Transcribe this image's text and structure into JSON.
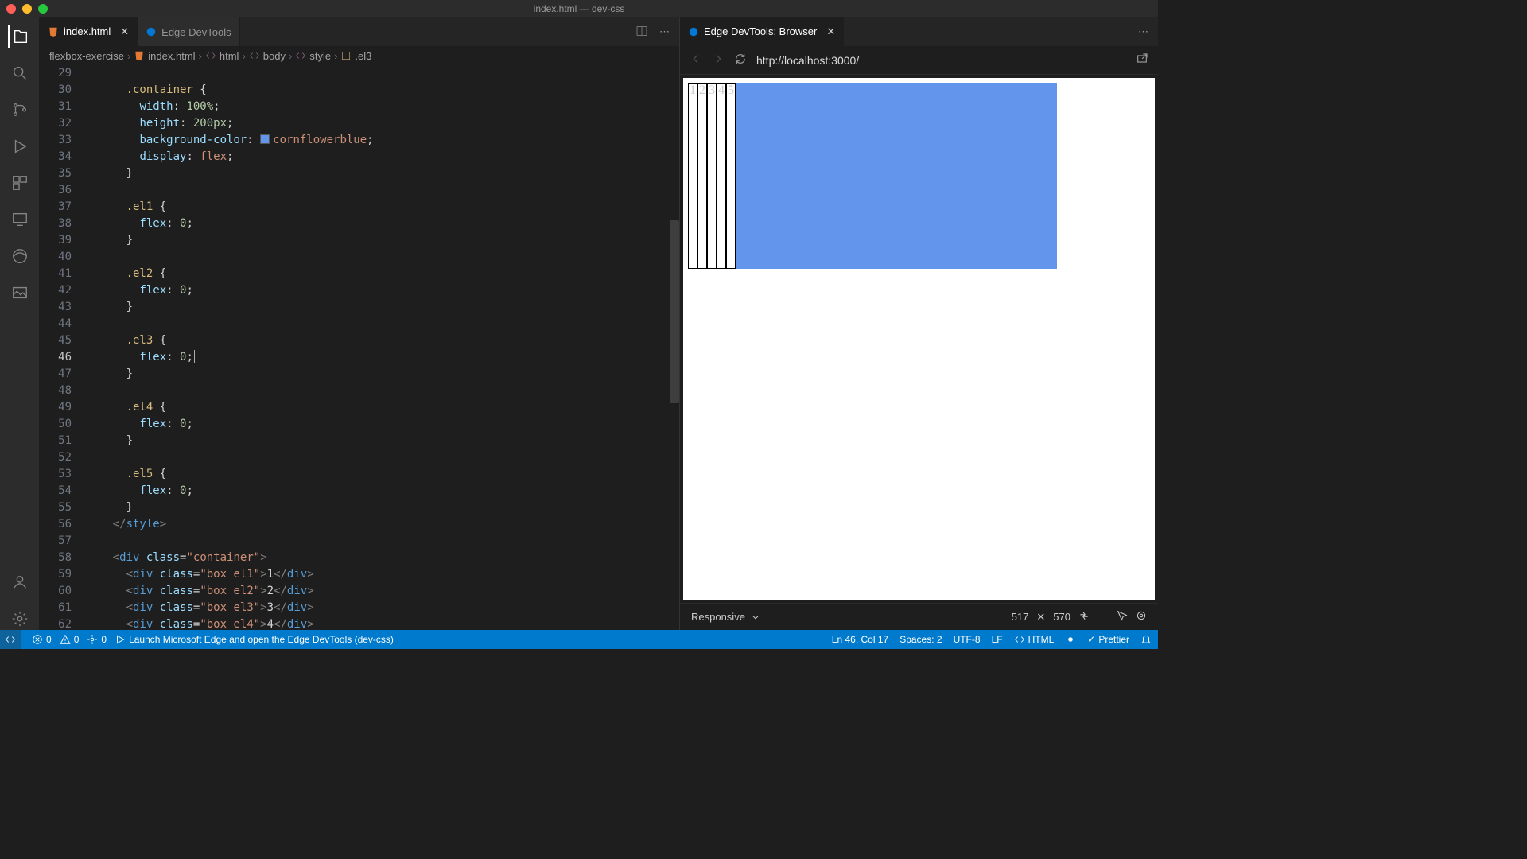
{
  "window": {
    "title": "index.html — dev-css"
  },
  "editor": {
    "tabs": [
      {
        "label": "index.html",
        "active": true,
        "icon": "html"
      },
      {
        "label": "Edge DevTools",
        "active": false,
        "icon": "edge"
      }
    ],
    "breadcrumbs": [
      "flexbox-exercise",
      "index.html",
      "html",
      "body",
      "style",
      ".el3"
    ]
  },
  "code": {
    "first_line": 29,
    "current_line": 46,
    "lines": [
      {
        "n": 29,
        "segs": []
      },
      {
        "n": 30,
        "segs": [
          [
            "      ",
            ""
          ],
          [
            ".container ",
            "sel"
          ],
          [
            "{",
            "brace"
          ]
        ]
      },
      {
        "n": 31,
        "segs": [
          [
            "        ",
            ""
          ],
          [
            "width",
            "prop"
          ],
          [
            ": ",
            "txt"
          ],
          [
            "100%",
            "num"
          ],
          [
            ";",
            "txt"
          ]
        ]
      },
      {
        "n": 32,
        "segs": [
          [
            "        ",
            ""
          ],
          [
            "height",
            "prop"
          ],
          [
            ": ",
            "txt"
          ],
          [
            "200px",
            "num"
          ],
          [
            ";",
            "txt"
          ]
        ]
      },
      {
        "n": 33,
        "segs": [
          [
            "        ",
            ""
          ],
          [
            "background-color",
            "prop"
          ],
          [
            ": ",
            "txt"
          ],
          [
            "__SWATCH__",
            "swatch"
          ],
          [
            "cornflowerblue",
            "val"
          ],
          [
            ";",
            "txt"
          ]
        ]
      },
      {
        "n": 34,
        "segs": [
          [
            "        ",
            ""
          ],
          [
            "display",
            "prop"
          ],
          [
            ": ",
            "txt"
          ],
          [
            "flex",
            "val"
          ],
          [
            ";",
            "txt"
          ]
        ]
      },
      {
        "n": 35,
        "segs": [
          [
            "      ",
            ""
          ],
          [
            "}",
            "brace"
          ]
        ]
      },
      {
        "n": 36,
        "segs": []
      },
      {
        "n": 37,
        "segs": [
          [
            "      ",
            ""
          ],
          [
            ".el1 ",
            "sel"
          ],
          [
            "{",
            "brace"
          ]
        ]
      },
      {
        "n": 38,
        "segs": [
          [
            "        ",
            ""
          ],
          [
            "flex",
            "prop"
          ],
          [
            ": ",
            "txt"
          ],
          [
            "0",
            "num"
          ],
          [
            ";",
            "txt"
          ]
        ]
      },
      {
        "n": 39,
        "segs": [
          [
            "      ",
            ""
          ],
          [
            "}",
            "brace"
          ]
        ]
      },
      {
        "n": 40,
        "segs": []
      },
      {
        "n": 41,
        "segs": [
          [
            "      ",
            ""
          ],
          [
            ".el2 ",
            "sel"
          ],
          [
            "{",
            "brace"
          ]
        ]
      },
      {
        "n": 42,
        "segs": [
          [
            "        ",
            ""
          ],
          [
            "flex",
            "prop"
          ],
          [
            ": ",
            "txt"
          ],
          [
            "0",
            "num"
          ],
          [
            ";",
            "txt"
          ]
        ]
      },
      {
        "n": 43,
        "segs": [
          [
            "      ",
            ""
          ],
          [
            "}",
            "brace"
          ]
        ]
      },
      {
        "n": 44,
        "segs": []
      },
      {
        "n": 45,
        "segs": [
          [
            "      ",
            ""
          ],
          [
            ".el3 ",
            "sel"
          ],
          [
            "{",
            "brace"
          ]
        ]
      },
      {
        "n": 46,
        "segs": [
          [
            "        ",
            ""
          ],
          [
            "flex",
            "prop"
          ],
          [
            ": ",
            "txt"
          ],
          [
            "0",
            "num"
          ],
          [
            ";",
            "txt"
          ],
          [
            "__CURSOR__",
            "cursor"
          ]
        ]
      },
      {
        "n": 47,
        "segs": [
          [
            "      ",
            ""
          ],
          [
            "}",
            "brace"
          ]
        ]
      },
      {
        "n": 48,
        "segs": []
      },
      {
        "n": 49,
        "segs": [
          [
            "      ",
            ""
          ],
          [
            ".el4 ",
            "sel"
          ],
          [
            "{",
            "brace"
          ]
        ]
      },
      {
        "n": 50,
        "segs": [
          [
            "        ",
            ""
          ],
          [
            "flex",
            "prop"
          ],
          [
            ": ",
            "txt"
          ],
          [
            "0",
            "num"
          ],
          [
            ";",
            "txt"
          ]
        ]
      },
      {
        "n": 51,
        "segs": [
          [
            "      ",
            ""
          ],
          [
            "}",
            "brace"
          ]
        ]
      },
      {
        "n": 52,
        "segs": []
      },
      {
        "n": 53,
        "segs": [
          [
            "      ",
            ""
          ],
          [
            ".el5 ",
            "sel"
          ],
          [
            "{",
            "brace"
          ]
        ]
      },
      {
        "n": 54,
        "segs": [
          [
            "        ",
            ""
          ],
          [
            "flex",
            "prop"
          ],
          [
            ": ",
            "txt"
          ],
          [
            "0",
            "num"
          ],
          [
            ";",
            "txt"
          ]
        ]
      },
      {
        "n": 55,
        "segs": [
          [
            "      ",
            ""
          ],
          [
            "}",
            "brace"
          ]
        ]
      },
      {
        "n": 56,
        "segs": [
          [
            "    ",
            ""
          ],
          [
            "</",
            "punc"
          ],
          [
            "style",
            "tag"
          ],
          [
            ">",
            "punc"
          ]
        ]
      },
      {
        "n": 57,
        "segs": []
      },
      {
        "n": 58,
        "segs": [
          [
            "    ",
            ""
          ],
          [
            "<",
            "punc"
          ],
          [
            "div ",
            "tag"
          ],
          [
            "class",
            "attr"
          ],
          [
            "=",
            "txt"
          ],
          [
            "\"container\"",
            "str"
          ],
          [
            ">",
            "punc"
          ]
        ]
      },
      {
        "n": 59,
        "segs": [
          [
            "      ",
            ""
          ],
          [
            "<",
            "punc"
          ],
          [
            "div ",
            "tag"
          ],
          [
            "class",
            "attr"
          ],
          [
            "=",
            "txt"
          ],
          [
            "\"box el1\"",
            "str"
          ],
          [
            ">",
            "punc"
          ],
          [
            "1",
            "txt"
          ],
          [
            "</",
            "punc"
          ],
          [
            "div",
            "tag"
          ],
          [
            ">",
            "punc"
          ]
        ]
      },
      {
        "n": 60,
        "segs": [
          [
            "      ",
            ""
          ],
          [
            "<",
            "punc"
          ],
          [
            "div ",
            "tag"
          ],
          [
            "class",
            "attr"
          ],
          [
            "=",
            "txt"
          ],
          [
            "\"box el2\"",
            "str"
          ],
          [
            ">",
            "punc"
          ],
          [
            "2",
            "txt"
          ],
          [
            "</",
            "punc"
          ],
          [
            "div",
            "tag"
          ],
          [
            ">",
            "punc"
          ]
        ]
      },
      {
        "n": 61,
        "segs": [
          [
            "      ",
            ""
          ],
          [
            "<",
            "punc"
          ],
          [
            "div ",
            "tag"
          ],
          [
            "class",
            "attr"
          ],
          [
            "=",
            "txt"
          ],
          [
            "\"box el3\"",
            "str"
          ],
          [
            ">",
            "punc"
          ],
          [
            "3",
            "txt"
          ],
          [
            "</",
            "punc"
          ],
          [
            "div",
            "tag"
          ],
          [
            ">",
            "punc"
          ]
        ]
      },
      {
        "n": 62,
        "segs": [
          [
            "      ",
            ""
          ],
          [
            "<",
            "punc"
          ],
          [
            "div ",
            "tag"
          ],
          [
            "class",
            "attr"
          ],
          [
            "=",
            "txt"
          ],
          [
            "\"box el4\"",
            "str"
          ],
          [
            ">",
            "punc"
          ],
          [
            "4",
            "txt"
          ],
          [
            "</",
            "punc"
          ],
          [
            "div",
            "tag"
          ],
          [
            ">",
            "punc"
          ]
        ]
      }
    ]
  },
  "browser": {
    "tab_label": "Edge DevTools: Browser",
    "url": "http://localhost:3000/",
    "cells": [
      "1",
      "2",
      "3",
      "4",
      "5"
    ],
    "device": "Responsive",
    "width": "517",
    "height": "570"
  },
  "status": {
    "errors": "0",
    "warnings": "0",
    "port": "0",
    "launch_text": "Launch Microsoft Edge and open the Edge DevTools (dev-css)",
    "position": "Ln 46, Col 17",
    "indent": "Spaces: 2",
    "encoding": "UTF-8",
    "eol": "LF",
    "language": "HTML",
    "prettier": "Prettier"
  }
}
